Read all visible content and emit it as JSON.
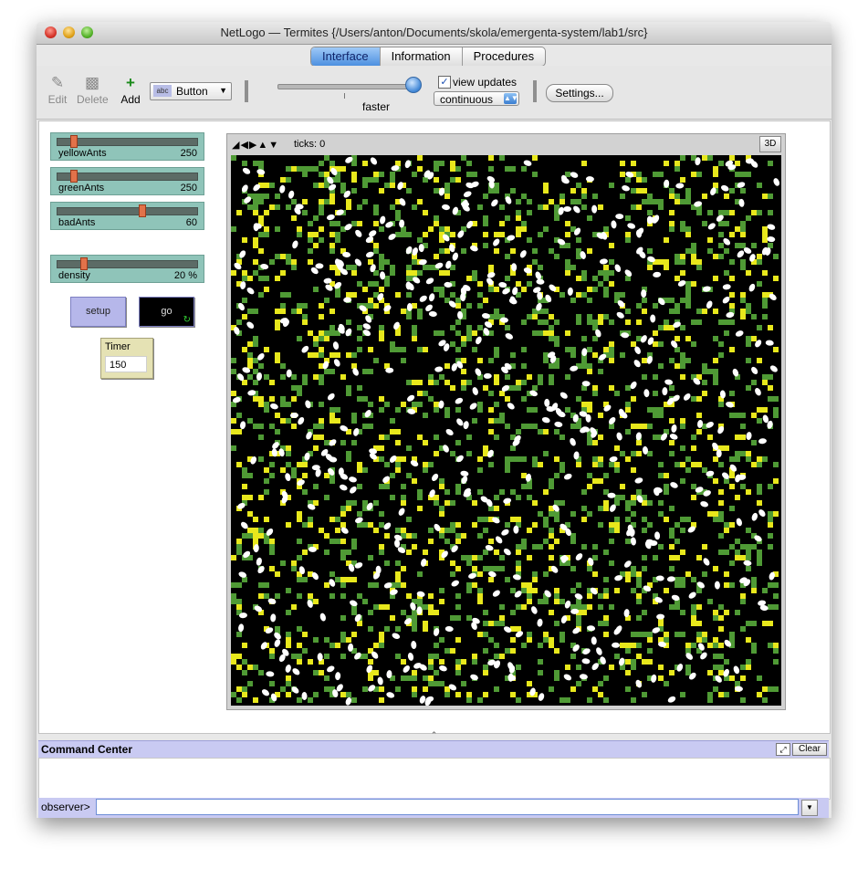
{
  "window": {
    "title": "NetLogo — Termites {/Users/anton/Documents/skola/emergenta-system/lab1/src}"
  },
  "tabs": [
    {
      "label": "Interface",
      "active": true
    },
    {
      "label": "Information",
      "active": false
    },
    {
      "label": "Procedures",
      "active": false
    }
  ],
  "toolbar": {
    "edit_label": "Edit",
    "delete_label": "Delete",
    "add_label": "Add",
    "widget_type": "Button",
    "widget_type_icon": "abc",
    "speed_label": "faster",
    "speed_value": 0.94,
    "view_updates_label": "view updates",
    "view_updates_checked": true,
    "update_mode": "continuous",
    "settings_label": "Settings..."
  },
  "sliders": [
    {
      "name": "yellowAnts",
      "value": "250",
      "fraction": 0.11
    },
    {
      "name": "greenAnts",
      "value": "250",
      "fraction": 0.11
    },
    {
      "name": "badAnts",
      "value": "60",
      "fraction": 0.6
    },
    {
      "name": "density",
      "value": "20 %",
      "fraction": 0.2
    }
  ],
  "buttons": {
    "setup_label": "setup",
    "go_label": "go",
    "go_loop_icon": "forever-arrows-icon"
  },
  "monitor": {
    "label": "Timer",
    "value": "150"
  },
  "view": {
    "ticks_label": "ticks: 0",
    "three_d_label": "3D",
    "colors": {
      "background": "#000000",
      "yellow_chip": "#e8e81c",
      "green_chip": "#4f9a35",
      "ant": "#ffffff"
    }
  },
  "command_center": {
    "title": "Command Center",
    "clear_label": "Clear",
    "prompt": "observer>",
    "input_value": ""
  }
}
